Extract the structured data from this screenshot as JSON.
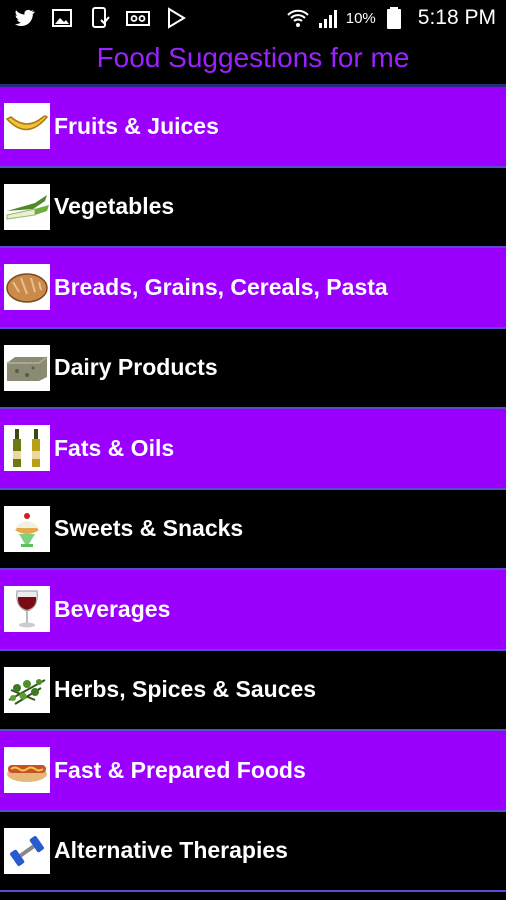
{
  "status_bar": {
    "battery_percent": "10%",
    "time": "5:18 PM",
    "icons": [
      "twitter-icon",
      "image-icon",
      "download-icon",
      "voicemail-icon",
      "play-store-icon",
      "wifi-icon",
      "signal-icon",
      "battery-icon"
    ]
  },
  "app": {
    "title": "Food Suggestions for me",
    "title_color": "#9b22ff",
    "accent_color": "#9b00ff"
  },
  "categories": [
    {
      "label": "Fruits & Juices",
      "icon": "banana-icon",
      "bg": "purple"
    },
    {
      "label": "Vegetables",
      "icon": "leek-icon",
      "bg": "black"
    },
    {
      "label": "Breads, Grains, Cereals, Pasta",
      "icon": "bread-icon",
      "bg": "purple"
    },
    {
      "label": "Dairy Products",
      "icon": "cheese-icon",
      "bg": "black"
    },
    {
      "label": "Fats & Oils",
      "icon": "oil-bottles-icon",
      "bg": "purple"
    },
    {
      "label": "Sweets & Snacks",
      "icon": "sundae-icon",
      "bg": "black"
    },
    {
      "label": "Beverages",
      "icon": "wine-glass-icon",
      "bg": "purple"
    },
    {
      "label": "Herbs, Spices & Sauces",
      "icon": "herbs-icon",
      "bg": "black"
    },
    {
      "label": "Fast & Prepared Foods",
      "icon": "hotdog-icon",
      "bg": "purple"
    },
    {
      "label": "Alternative Therapies",
      "icon": "dumbbell-icon",
      "bg": "black"
    }
  ]
}
